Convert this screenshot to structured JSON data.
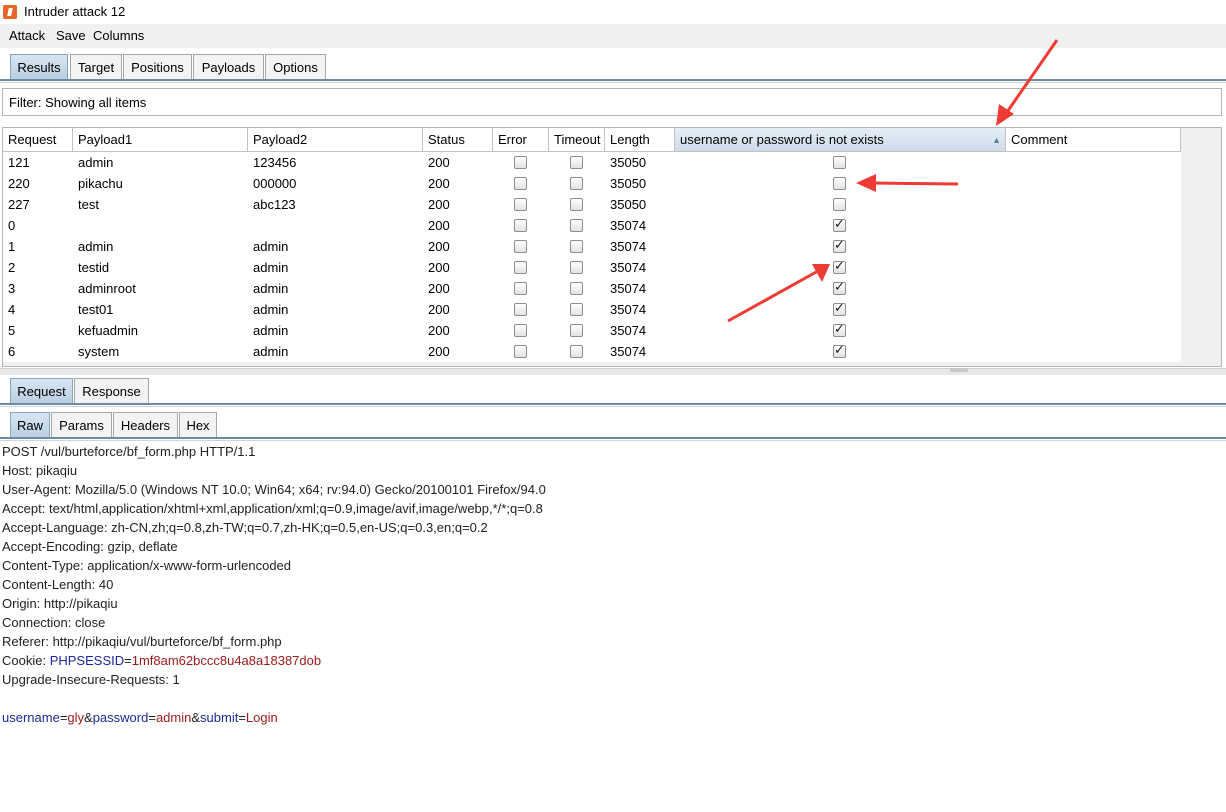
{
  "window": {
    "title": "Intruder attack 12"
  },
  "menu": [
    "Attack",
    "Save",
    "Columns"
  ],
  "main_tabs": [
    "Results",
    "Target",
    "Positions",
    "Payloads",
    "Options"
  ],
  "filter": "Filter: Showing all items",
  "columns": [
    "Request",
    "Payload1",
    "Payload2",
    "Status",
    "Error",
    "Timeout",
    "Length",
    "username or password is not exists",
    "Comment"
  ],
  "rows": [
    {
      "request": "121",
      "payload1": "admin",
      "payload2": "123456",
      "status": "200",
      "error": false,
      "timeout": false,
      "length": "35050",
      "match": false
    },
    {
      "request": "220",
      "payload1": "pikachu",
      "payload2": "000000",
      "status": "200",
      "error": false,
      "timeout": false,
      "length": "35050",
      "match": false
    },
    {
      "request": "227",
      "payload1": "test",
      "payload2": "abc123",
      "status": "200",
      "error": false,
      "timeout": false,
      "length": "35050",
      "match": false
    },
    {
      "request": "0",
      "payload1": "",
      "payload2": "",
      "status": "200",
      "error": false,
      "timeout": false,
      "length": "35074",
      "match": true
    },
    {
      "request": "1",
      "payload1": "admin",
      "payload2": "admin",
      "status": "200",
      "error": false,
      "timeout": false,
      "length": "35074",
      "match": true
    },
    {
      "request": "2",
      "payload1": "testid",
      "payload2": "admin",
      "status": "200",
      "error": false,
      "timeout": false,
      "length": "35074",
      "match": true
    },
    {
      "request": "3",
      "payload1": "adminroot",
      "payload2": "admin",
      "status": "200",
      "error": false,
      "timeout": false,
      "length": "35074",
      "match": true
    },
    {
      "request": "4",
      "payload1": "test01",
      "payload2": "admin",
      "status": "200",
      "error": false,
      "timeout": false,
      "length": "35074",
      "match": true
    },
    {
      "request": "5",
      "payload1": "kefuadmin",
      "payload2": "admin",
      "status": "200",
      "error": false,
      "timeout": false,
      "length": "35074",
      "match": true
    },
    {
      "request": "6",
      "payload1": "system",
      "payload2": "admin",
      "status": "200",
      "error": false,
      "timeout": false,
      "length": "35074",
      "match": true
    }
  ],
  "detail_tabs": [
    "Request",
    "Response"
  ],
  "view_tabs": [
    "Raw",
    "Params",
    "Headers",
    "Hex"
  ],
  "request_lines": [
    "POST /vul/burteforce/bf_form.php HTTP/1.1",
    "Host: pikaqiu",
    "User-Agent: Mozilla/5.0 (Windows NT 10.0; Win64; x64; rv:94.0) Gecko/20100101 Firefox/94.0",
    "Accept: text/html,application/xhtml+xml,application/xml;q=0.9,image/avif,image/webp,*/*;q=0.8",
    "Accept-Language: zh-CN,zh;q=0.8,zh-TW;q=0.7,zh-HK;q=0.5,en-US;q=0.3,en;q=0.2",
    "Accept-Encoding: gzip, deflate",
    "Content-Type: application/x-www-form-urlencoded",
    "Content-Length: 40",
    "Origin: http://pikaqiu",
    "Connection: close",
    "Referer: http://pikaqiu/vul/burteforce/bf_form.php"
  ],
  "cookie": {
    "label": "Cookie: ",
    "name": "PHPSESSID",
    "eq": "=",
    "value": "1mf8am62bccc8u4a8a18387dob"
  },
  "upgrade_line": "Upgrade-Insecure-Requests: 1",
  "body_params": [
    {
      "name": "username",
      "value": "gly"
    },
    {
      "name": "password",
      "value": "admin"
    },
    {
      "name": "submit",
      "value": "Login"
    }
  ],
  "colors": {
    "annotation_arrow": "#ee3b36",
    "param_name": "#1a2a9c",
    "param_value": "#9c1a1a"
  }
}
